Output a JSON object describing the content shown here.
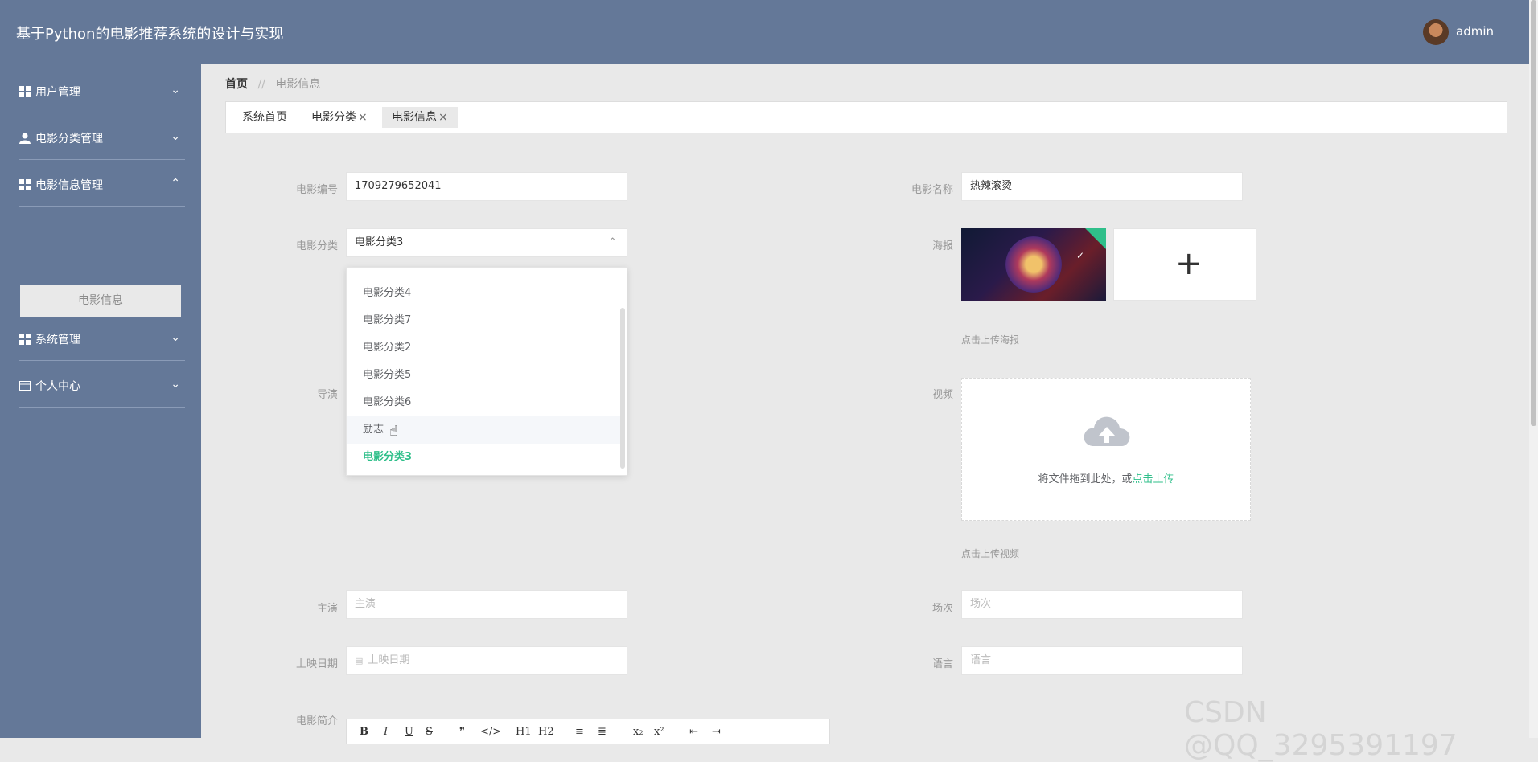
{
  "header": {
    "title": "基于Python的电影推荐系统的设计与实现",
    "username": "admin"
  },
  "sidebar": {
    "items": [
      {
        "label": "用户管理",
        "icon": "grid-icon",
        "chevron": "⌄"
      },
      {
        "label": "电影分类管理",
        "icon": "user-icon",
        "chevron": "⌄"
      },
      {
        "label": "电影信息管理",
        "icon": "grid-icon",
        "chevron": "⌃"
      },
      {
        "label": "系统管理",
        "icon": "grid-icon",
        "chevron": "⌄"
      },
      {
        "label": "个人中心",
        "icon": "card-icon",
        "chevron": "⌄"
      }
    ],
    "sub_item": "电影信息"
  },
  "breadcrumb": {
    "home": "首页",
    "separator": "//",
    "current": "电影信息"
  },
  "tabs": [
    {
      "label": "系统首页",
      "close": ""
    },
    {
      "label": "电影分类",
      "close": "×"
    },
    {
      "label": "电影信息",
      "close": "×"
    }
  ],
  "form": {
    "movie_no_label": "电影编号",
    "movie_no_value": "1709279652041",
    "movie_name_label": "电影名称",
    "movie_name_value": "热辣滚烫",
    "category_label": "电影分类",
    "category_value": "电影分类3",
    "category_chevron": "⌃",
    "poster_label": "海报",
    "poster_hint": "点击上传海报",
    "director_label": "导演",
    "video_label": "视频",
    "video_drop_text": "将文件拖到此处，或",
    "video_drop_link": "点击上传",
    "video_hint": "点击上传视频",
    "actor_label": "主演",
    "actor_placeholder": "主演",
    "session_label": "场次",
    "session_placeholder": "场次",
    "release_label": "上映日期",
    "release_placeholder": "上映日期",
    "language_label": "语言",
    "language_placeholder": "语言",
    "intro_label": "电影简介"
  },
  "dropdown": {
    "options": [
      "电影分类4",
      "电影分类7",
      "电影分类2",
      "电影分类5",
      "电影分类6",
      "励志",
      "电影分类3"
    ],
    "hover_index": 5,
    "selected": "电影分类3"
  },
  "editor_toolbar": [
    "B",
    "I",
    "U",
    "S",
    "❞",
    "</>",
    "H1",
    "H2",
    "≡",
    "≣",
    "x₂",
    "x²",
    "⇤",
    "⇥"
  ],
  "watermark": "CSDN @QQ_3295391197",
  "colors": {
    "header": "#647898",
    "accent": "#2fbf8a",
    "background": "#e9e9e9"
  }
}
